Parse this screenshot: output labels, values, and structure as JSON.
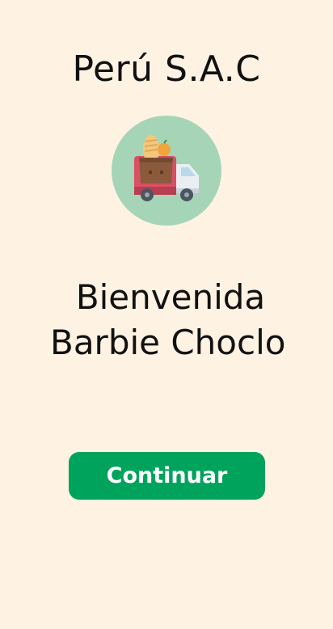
{
  "header": {
    "company_name": "Perú S.A.C"
  },
  "logo": {
    "icon": "delivery-truck-icon",
    "background_color": "#a5d5b6"
  },
  "welcome": {
    "greeting": "Bienvenida",
    "user_name": "Barbie Choclo"
  },
  "actions": {
    "continue_label": "Continuar",
    "continue_color": "#00a35c"
  },
  "theme": {
    "background": "#fef2e3"
  }
}
